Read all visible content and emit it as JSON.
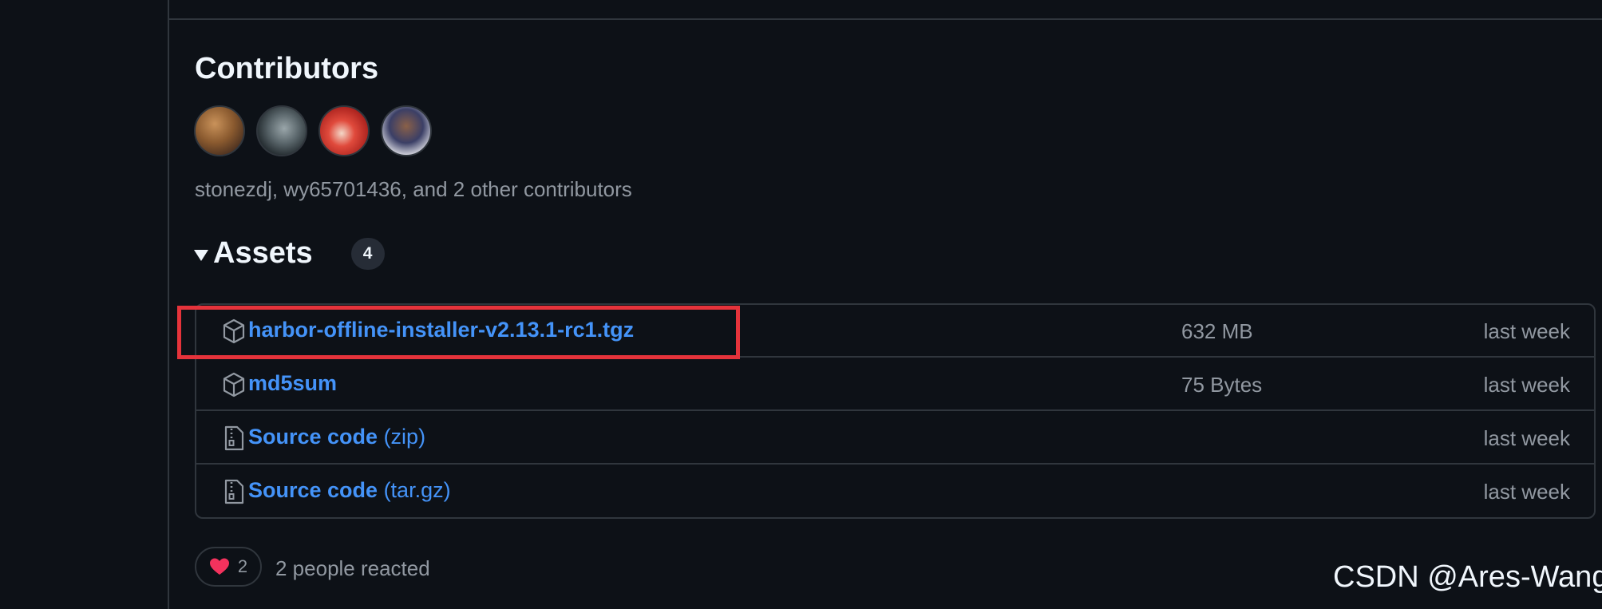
{
  "contributors": {
    "title": "Contributors",
    "avatars": [
      "avatar-1",
      "avatar-2",
      "avatar-3",
      "avatar-4"
    ],
    "summary": "stonezdj, wy65701436, and 2 other contributors"
  },
  "assets": {
    "title": "Assets",
    "count": "4",
    "items": [
      {
        "icon": "package-icon",
        "name": "harbor-offline-installer-v2.13.1-rc1.tgz",
        "ext": "",
        "size": "632 MB",
        "when": "last week"
      },
      {
        "icon": "package-icon",
        "name": "md5sum",
        "ext": "",
        "size": "75 Bytes",
        "when": "last week"
      },
      {
        "icon": "zip-file-icon",
        "name": "Source code",
        "ext": " (zip)",
        "size": "",
        "when": "last week"
      },
      {
        "icon": "zip-file-icon",
        "name": "Source code",
        "ext": " (tar.gz)",
        "size": "",
        "when": "last week"
      }
    ]
  },
  "reactions": {
    "count": "2",
    "text": "2 people reacted"
  },
  "watermark": "CSDN @Ares-Wang",
  "colors": {
    "background": "#0d1117",
    "link": "#4493f8",
    "muted": "#9198a1",
    "border": "#30363d",
    "highlight": "#e5333b"
  }
}
